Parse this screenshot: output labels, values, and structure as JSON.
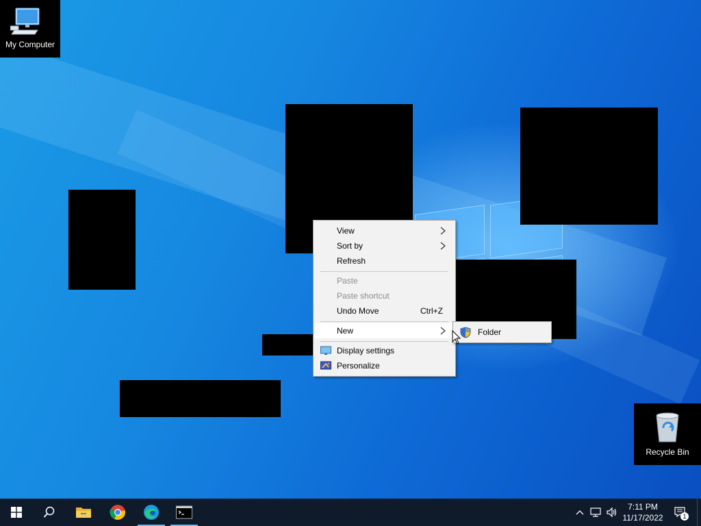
{
  "desktop": {
    "icons": {
      "my_computer": "My Computer",
      "recycle_bin": "Recycle Bin"
    }
  },
  "context_menu": {
    "view": "View",
    "sort_by": "Sort by",
    "refresh": "Refresh",
    "paste": "Paste",
    "paste_shortcut": "Paste shortcut",
    "undo_move": "Undo Move",
    "undo_move_shortcut": "Ctrl+Z",
    "new": "New",
    "display_settings": "Display settings",
    "personalize": "Personalize"
  },
  "submenu": {
    "folder": "Folder"
  },
  "taskbar": {
    "apps": [
      "start-icon",
      "search-icon",
      "file-explorer-icon",
      "chrome-icon",
      "edge-icon",
      "terminal-icon"
    ],
    "clock": {
      "time": "7:11 PM",
      "date": "11/17/2022"
    },
    "notifications_count": "1"
  },
  "colors": {
    "taskbar": "#0f1a2b",
    "menu_bg": "#f2f2f2",
    "accent": "#77b8f0"
  }
}
